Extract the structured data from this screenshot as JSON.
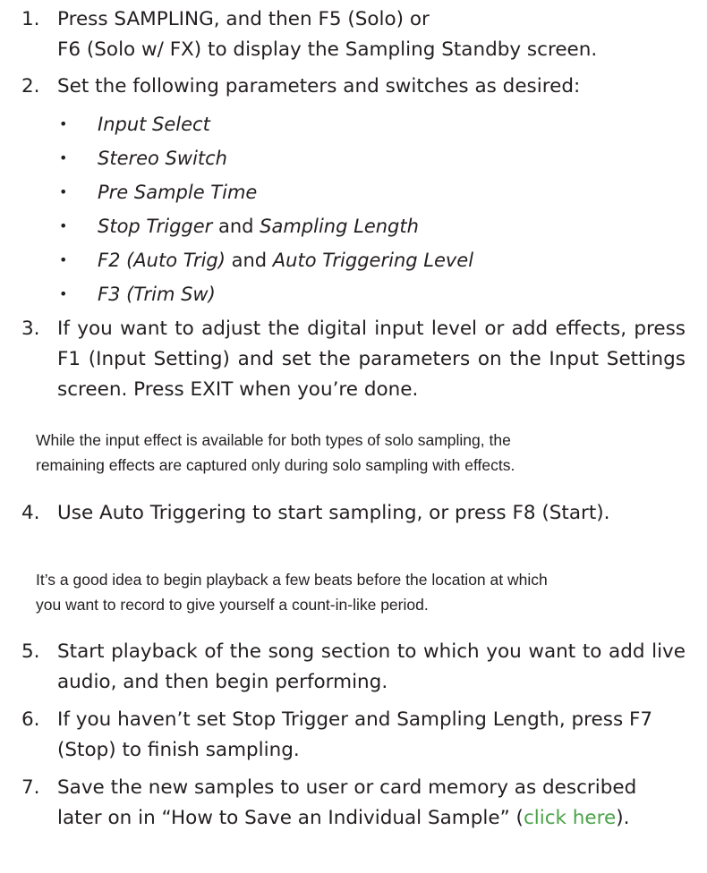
{
  "steps": [
    {
      "num": "1.",
      "lines": [
        "Press SAMPLING, and then F5 (Solo) or",
        "F6 (Solo w/ FX) to display the Sampling Standby screen."
      ]
    },
    {
      "num": "2.",
      "text": "Set the following parameters and switches as desired:"
    },
    {
      "num": "3.",
      "text": "If you want to adjust the digital input level or add effects, press F1 (Input Setting) and set the parameters on the Input Settings screen. Press EXIT when you’re done."
    },
    {
      "num": "4.",
      "text": "Use Auto Triggering to start sampling, or press F8 (Start)."
    },
    {
      "num": "5.",
      "text": "Start playback of the song section to which you want to add live audio, and then begin performing."
    },
    {
      "num": "6.",
      "text": "If you haven’t set Stop Trigger and Sampling Length, press F7 (Stop) to finish sampling."
    },
    {
      "num": "7.",
      "text_before": "Save the new samples to user or card memory as described later on in “How to Save an Individual Sample” (",
      "link": "click here",
      "text_after": ")."
    }
  ],
  "bullets": [
    {
      "marker": "•",
      "italic": "Input Select"
    },
    {
      "marker": "•",
      "italic": "Stereo Switch"
    },
    {
      "marker": "•",
      "italic": "Pre Sample Time"
    },
    {
      "marker": "•",
      "italic": "Stop Trigger",
      "plain": " and ",
      "italic2": "Sampling Length"
    },
    {
      "marker": "•",
      "italic": "F2 (Auto Trig)",
      "plain": " and ",
      "italic2": "Auto Triggering Level"
    },
    {
      "marker": "•",
      "italic": "F3 (Trim Sw)"
    }
  ],
  "notes": [
    {
      "lines": [
        "While the input effect is available for both types of solo sampling, the",
        "remaining effects are captured only during solo sampling with effects."
      ]
    },
    {
      "lines": [
        "It’s a good idea to begin playback a few beats before the location at which",
        "you want to record to give yourself a count-in-like period."
      ]
    }
  ],
  "colors": {
    "text": "#231f20",
    "link": "#4aa347"
  }
}
